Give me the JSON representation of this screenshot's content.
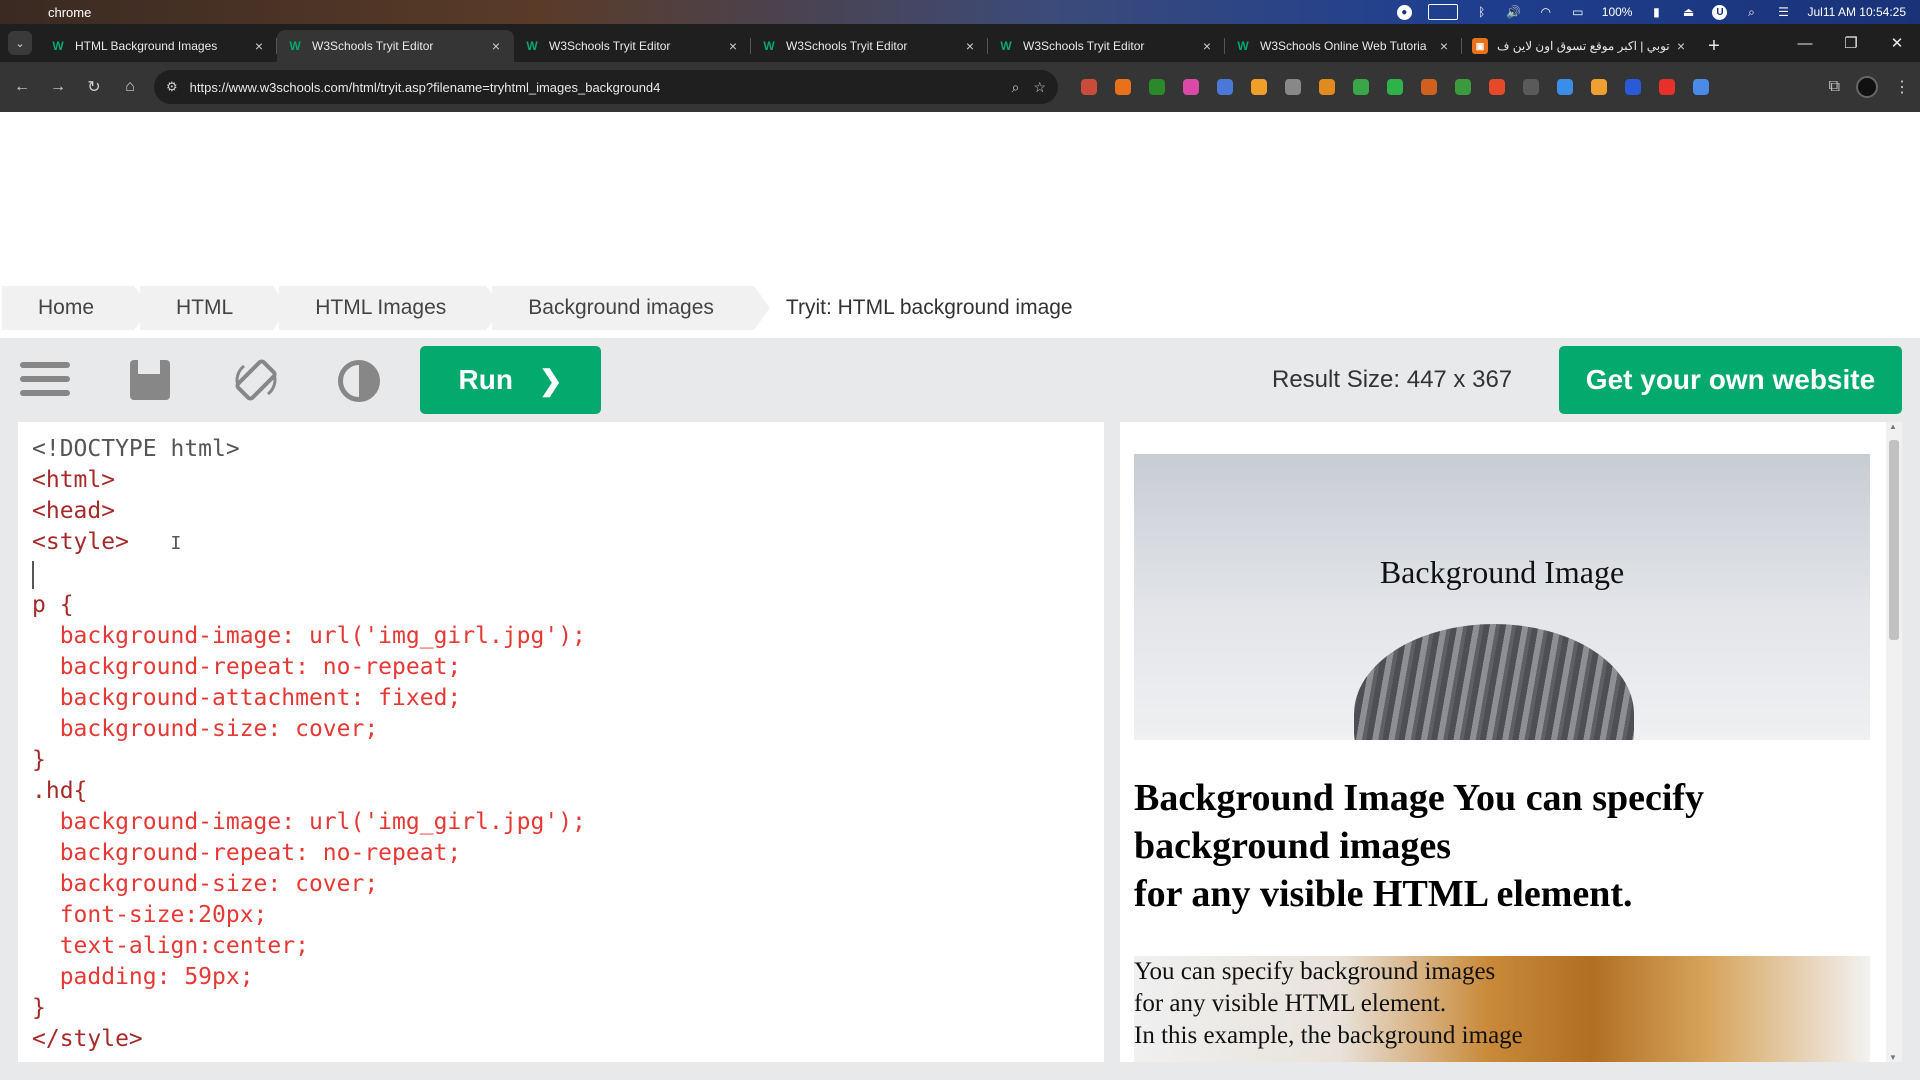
{
  "os": {
    "app_name": "chrome",
    "battery": "100%",
    "datetime": "Jul11 AM 10:54:25"
  },
  "tabs": [
    {
      "title": "HTML Background Images",
      "active": false
    },
    {
      "title": "W3Schools Tryit Editor",
      "active": true
    },
    {
      "title": "W3Schools Tryit Editor",
      "active": false
    },
    {
      "title": "W3Schools Tryit Editor",
      "active": false
    },
    {
      "title": "W3Schools Tryit Editor",
      "active": false
    },
    {
      "title": "W3Schools Online Web Tutoria",
      "active": false
    },
    {
      "title": "توبي | اكبر موقع تسوق اون لاين ف",
      "active": false
    }
  ],
  "address": {
    "url": "https://www.w3schools.com/html/tryit.asp?filename=tryhtml_images_background4"
  },
  "breadcrumb": [
    "Home",
    "HTML",
    "HTML Images",
    "Background images"
  ],
  "breadcrumb_current": "Tryit: HTML background image",
  "toolbar": {
    "run_label": "Run",
    "run_chevron": "❯",
    "result_size": "Result Size: 447 x 367",
    "own_website": "Get your own website"
  },
  "code_lines": [
    "<!DOCTYPE html>",
    "<html>",
    "<head>",
    "<style>",
    "",
    "p {",
    "  background-image: url('img_girl.jpg');",
    "  background-repeat: no-repeat;",
    "  background-attachment: fixed;",
    "  background-size: cover;",
    "}",
    ".hd{",
    "  background-image: url('img_girl.jpg');",
    "  background-repeat: no-repeat;",
    "  background-size: cover;",
    "  font-size:20px;",
    "  text-align:center;",
    "  padding: 59px;",
    "}",
    "</style>"
  ],
  "result": {
    "hd_text": "Background Image",
    "heading_lines": [
      "Background Image You can specify",
      "background images",
      "for any visible HTML element."
    ],
    "paragraph_lines": [
      "You can specify background images",
      "for any visible HTML element.",
      "In this example, the background image"
    ]
  },
  "colors": {
    "accent_green": "#04aa6d",
    "toolbar_gray": "#e7e9eb",
    "code_tag": "#a52a2a",
    "code_prop": "#e53935",
    "code_value": "#0000cd"
  }
}
